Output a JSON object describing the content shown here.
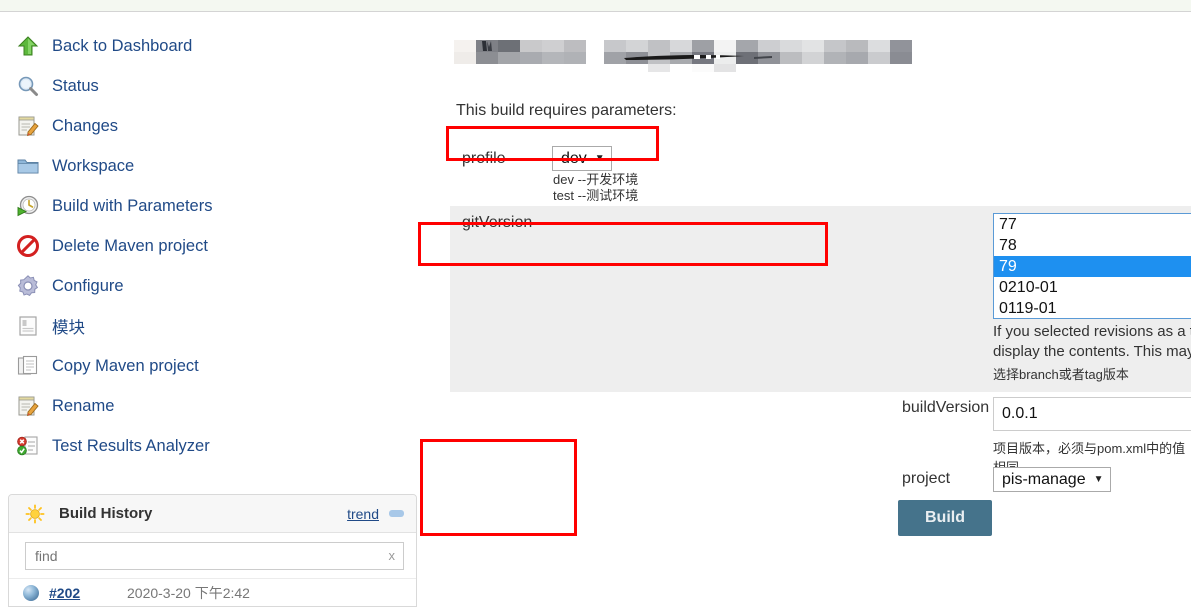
{
  "sidebar": {
    "tasks": [
      {
        "label": "Back to Dashboard",
        "icon": "up-arrow-icon"
      },
      {
        "label": "Status",
        "icon": "magnifier-icon"
      },
      {
        "label": "Changes",
        "icon": "notepad-pencil-icon"
      },
      {
        "label": "Workspace",
        "icon": "folder-icon"
      },
      {
        "label": "Build with Parameters",
        "icon": "clock-play-icon"
      },
      {
        "label": "Delete Maven project",
        "icon": "no-entry-icon"
      },
      {
        "label": "Configure",
        "icon": "gear-icon"
      },
      {
        "label": "模块",
        "icon": "document-icon"
      },
      {
        "label": "Copy Maven project",
        "icon": "copy-documents-icon"
      },
      {
        "label": "Rename",
        "icon": "notepad-pencil-icon"
      },
      {
        "label": "Test Results Analyzer",
        "icon": "test-results-icon"
      }
    ],
    "build_history": {
      "title": "Build History",
      "sun_icon": "sun-icon",
      "trend_label": "trend",
      "minimize_icon": "minimize-icon",
      "find_placeholder": "find",
      "find_value": "",
      "clear_label": "x",
      "rows": [
        {
          "status_icon": "blue-ball-icon",
          "number": "#202",
          "date": "2020-3-20 下午2:42"
        }
      ]
    }
  },
  "main": {
    "page_title_blurred": "",
    "requires_parameters_text": "This build requires parameters:",
    "parameters": [
      {
        "name": "profile",
        "type": "select",
        "value": "dev",
        "caret": "▼",
        "description_lines": [
          "dev  --开发环境",
          "test  --测试环境"
        ]
      },
      {
        "name": "gitVersion",
        "type": "listbox",
        "options": [
          "77",
          "78",
          "79",
          "0210-01",
          "0119-01"
        ],
        "selected": "79",
        "scroll_up_icon": "▲",
        "scroll_down_icon": "▼",
        "description": "If you selected revisions as a type of presented data and working space is empty, the p",
        "description_line2": "display the contents. This may take some time if you have a slow connection or reposit",
        "description_cn": "选择branch或者tag版本"
      },
      {
        "name": "buildVersion",
        "type": "text",
        "value": "0.0.1",
        "placeholder": "",
        "description_cn": "项目版本，必须与pom.xml中的值相同"
      },
      {
        "name": "project",
        "type": "select",
        "value": "pis-manage",
        "caret": "▼"
      }
    ],
    "build_button_label": "Build"
  },
  "annotations": {
    "color": "#ff0000",
    "boxes": [
      "profile-row",
      "gitversion-options",
      "build-button-area"
    ]
  }
}
